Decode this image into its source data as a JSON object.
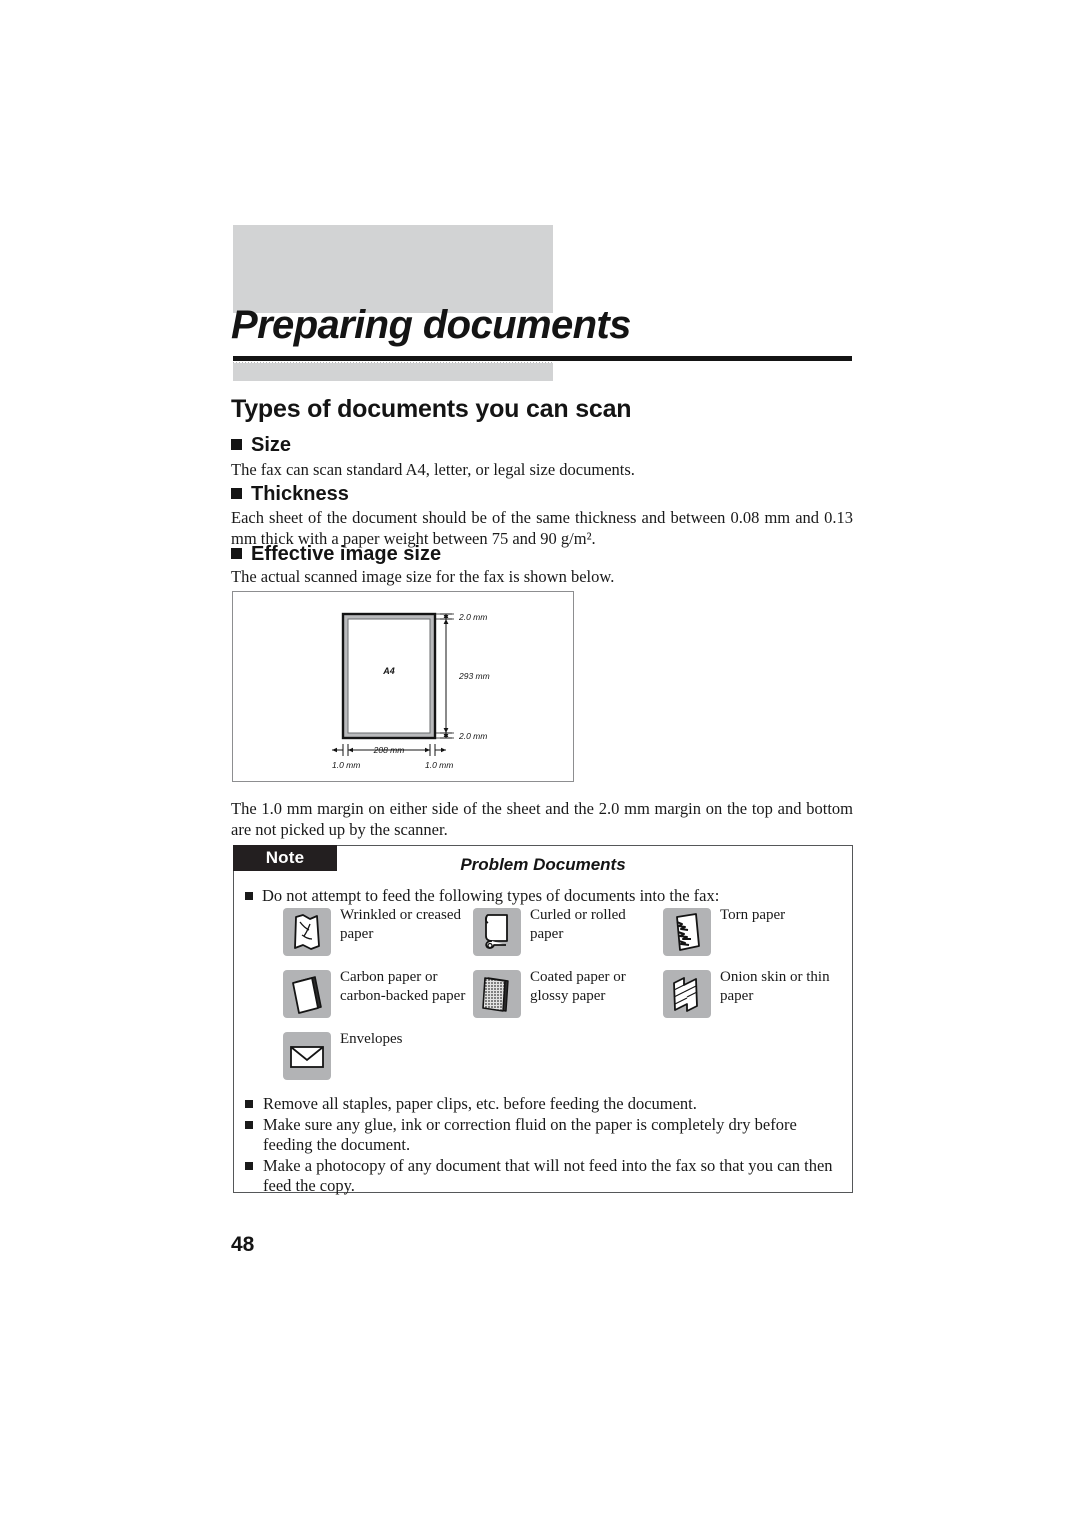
{
  "document": {
    "chapter_title": "Preparing documents",
    "page_number": "48"
  },
  "section": {
    "title": "Types of documents you can scan",
    "subsections": [
      {
        "heading": "Size",
        "body": "The fax can scan standard A4, letter, or legal size documents."
      },
      {
        "heading": "Thickness",
        "body": "Each sheet of the document should be of the same thickness and between 0.08 mm and 0.13 mm thick with a paper weight between 75 and 90 g/m²."
      },
      {
        "heading": "Effective image size",
        "body": "The actual scanned image size for the fax is shown below."
      }
    ],
    "after_diagram_text": "The 1.0 mm margin on either side of the sheet and the 2.0 mm margin on the top and bottom are not picked up by the scanner."
  },
  "diagram": {
    "sheet_label": "A4",
    "top_margin": "2.0 mm",
    "bottom_margin": "2.0 mm",
    "height_dim": "293 mm",
    "width_dim": "208 mm",
    "left_margin": "1.0 mm",
    "right_margin": "1.0 mm"
  },
  "note": {
    "tab_label": "Note",
    "heading": "Problem Documents",
    "intro": "Do not attempt to feed the following types of documents into the fax:",
    "icons": [
      {
        "icon": "wrinkled-paper-icon",
        "label": "Wrinkled or creased paper"
      },
      {
        "icon": "curled-paper-icon",
        "label": "Curled or rolled paper"
      },
      {
        "icon": "torn-paper-icon",
        "label": "Torn paper"
      },
      {
        "icon": "carbon-paper-icon",
        "label": "Carbon paper or carbon-backed paper"
      },
      {
        "icon": "coated-paper-icon",
        "label": "Coated paper or glossy paper"
      },
      {
        "icon": "onion-skin-paper-icon",
        "label": "Onion skin or thin paper"
      },
      {
        "icon": "envelope-icon",
        "label": "Envelopes"
      }
    ],
    "bullets": [
      "Remove all staples, paper clips, etc. before feeding the document.",
      "Make sure any glue, ink or correction fluid on the paper is completely dry before feeding the document.",
      "Make a photocopy of any document that will not feed into the fax so that you can then feed the copy."
    ]
  },
  "colors": {
    "header_block": "#d2d3d4",
    "rule": "#141414",
    "note_tab_bg": "#231f20",
    "icon_tile_bg": "#b2b3b5"
  }
}
